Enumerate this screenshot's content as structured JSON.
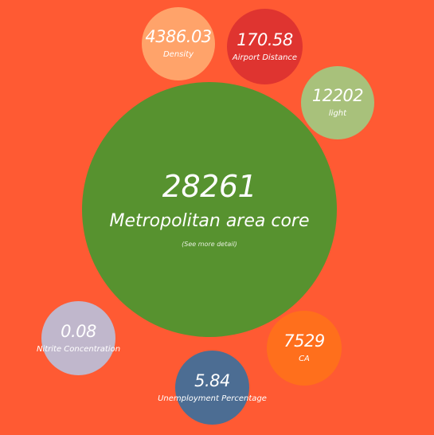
{
  "main": {
    "value": "28261",
    "label": "Metropolitan area core",
    "detail_link": "(See more detail)",
    "color": "#57922f"
  },
  "bubbles": [
    {
      "value": "4386.03",
      "label": "Density",
      "color": "#ffa36a"
    },
    {
      "value": "170.58",
      "label": "Airport Distance",
      "color": "#df3430"
    },
    {
      "value": "12202",
      "label": "light",
      "color": "#a8c17b"
    },
    {
      "value": "0.08",
      "label": "Nitrite Concentration",
      "color": "#c0b7cc"
    },
    {
      "value": "7529",
      "label": "CA",
      "color": "#ff6f1c"
    },
    {
      "value": "5.84",
      "label": "Unemployment Percentage",
      "color": "#4c6d93"
    }
  ],
  "background_color": "#ff5a33"
}
